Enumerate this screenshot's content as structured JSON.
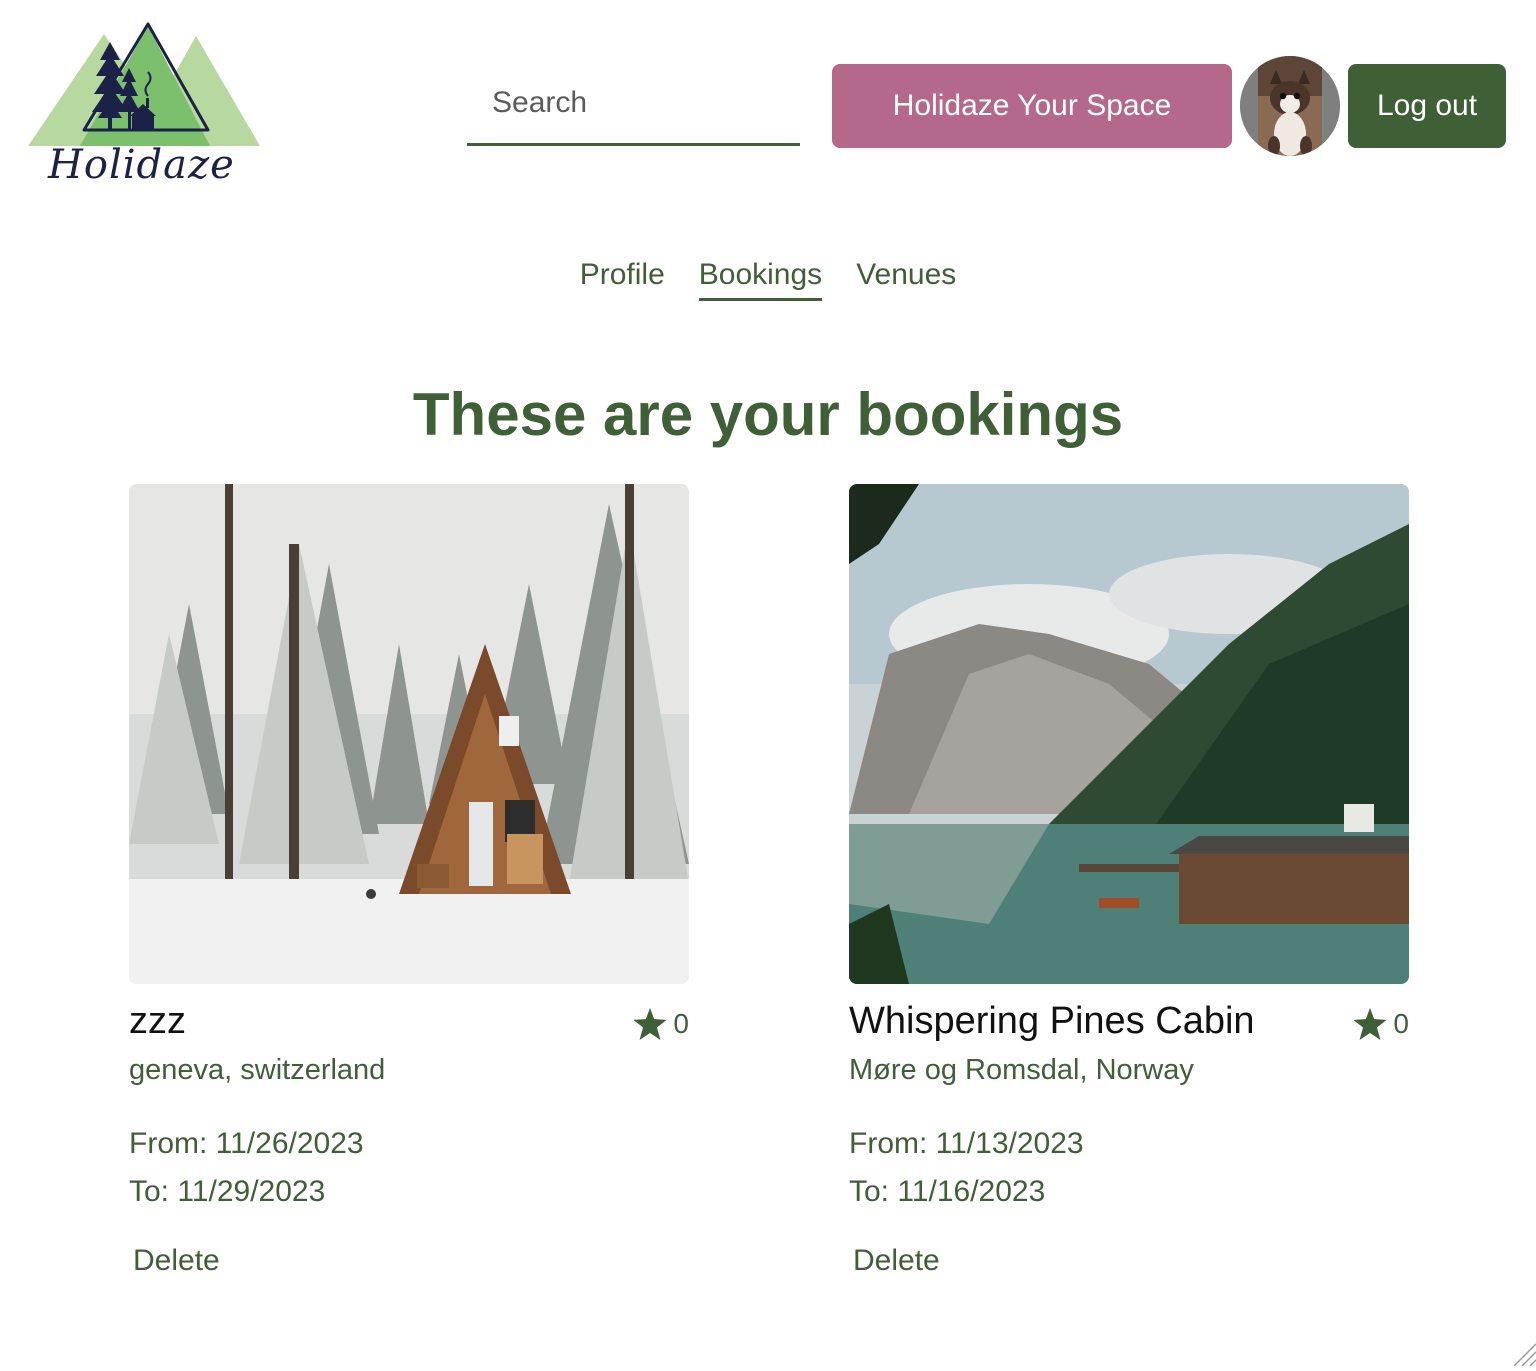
{
  "brand": {
    "name": "Holidaze"
  },
  "header": {
    "search_placeholder": "Search",
    "host_button": "Holidaze Your Space",
    "logout_button": "Log out"
  },
  "tabs": [
    {
      "label": "Profile",
      "active": false
    },
    {
      "label": "Bookings",
      "active": true
    },
    {
      "label": "Venues",
      "active": false
    }
  ],
  "page": {
    "title": "These are your bookings"
  },
  "bookings": [
    {
      "name": "zzz",
      "rating": "0",
      "location": "geneva, switzerland",
      "from": "From: 11/26/2023",
      "to": "To: 11/29/2023",
      "delete_label": "Delete"
    },
    {
      "name": "Whispering Pines Cabin",
      "rating": "0",
      "location": "Møre og Romsdal, Norway",
      "from": "From: 11/13/2023",
      "to": "To: 11/16/2023",
      "delete_label": "Delete"
    }
  ],
  "colors": {
    "primary_green": "#3f5f37",
    "accent_pink": "#b4698b",
    "logo_green_light": "#b7d9a0",
    "logo_green": "#7cbf6c",
    "logo_navy": "#1c2247"
  },
  "icons": {
    "rating": "star-icon",
    "logo": "mountain-logo-icon"
  }
}
